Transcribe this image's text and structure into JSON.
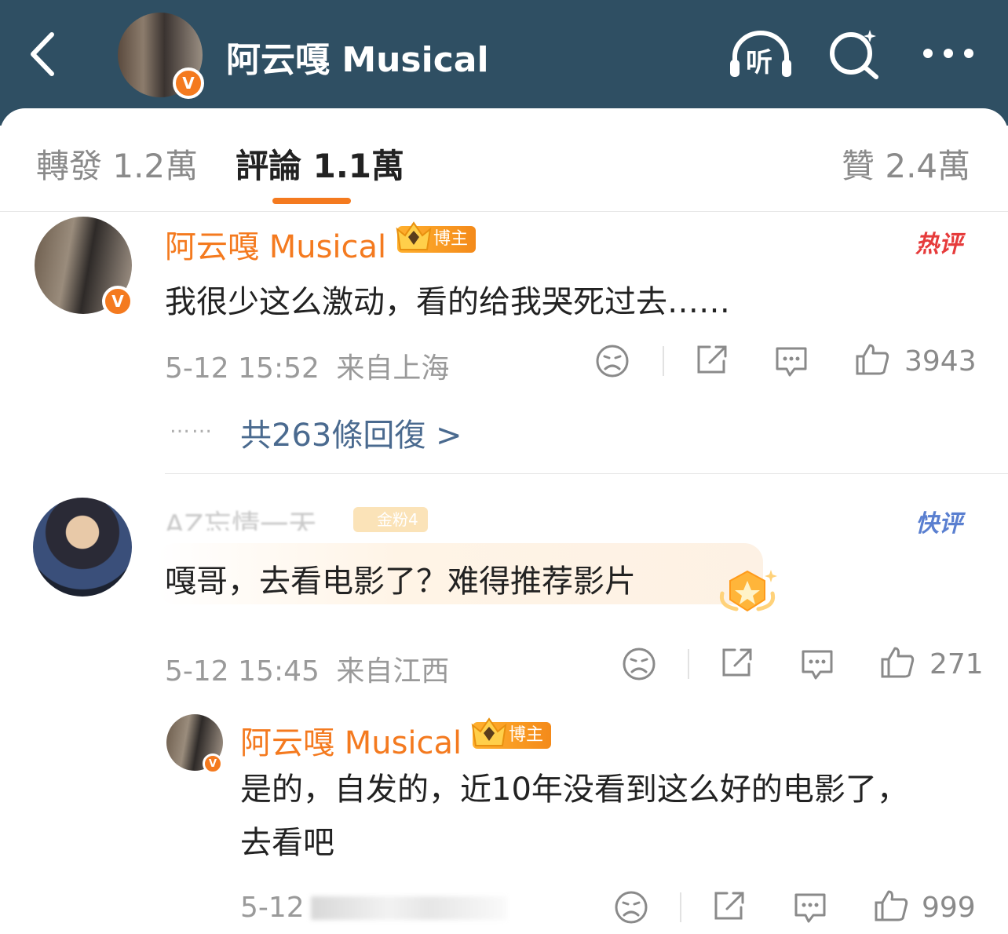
{
  "header": {
    "title": "阿云嘎 Musical",
    "verified_mark": "V",
    "icons": [
      "back-icon",
      "listen-icon",
      "search-icon",
      "more-icon"
    ],
    "listen_label": "听",
    "bg_color": "#2f4f63"
  },
  "tabs": [
    {
      "label": "轉發 1.2萬",
      "active": false
    },
    {
      "label": "評論 1.1萬",
      "active": true
    },
    {
      "label": "贊 2.4萬",
      "active": false
    }
  ],
  "accent_color": "#f47a1f",
  "comments": [
    {
      "user": "阿云嘎 Musical",
      "badge": "博主",
      "tag": "热评",
      "text": "我很少这么激动，看的给我哭死过去……",
      "time": "5-12 15:52",
      "location": "来自上海",
      "likes": "3943",
      "replies_link": "共263條回復 >",
      "replies_dots": "……"
    },
    {
      "user": "AZ忘情一天",
      "badge": "金粉4",
      "tag": "快评",
      "text": "嘎哥，去看电影了？难得推荐影片",
      "time": "5-12 15:45",
      "location": "来自江西",
      "likes": "271"
    }
  ],
  "reply": {
    "user": "阿云嘎 Musical",
    "badge": "博主",
    "text": "是的，自发的，近10年没看到这么好的电影了，去看吧",
    "time": "5-12",
    "likes": "999"
  }
}
